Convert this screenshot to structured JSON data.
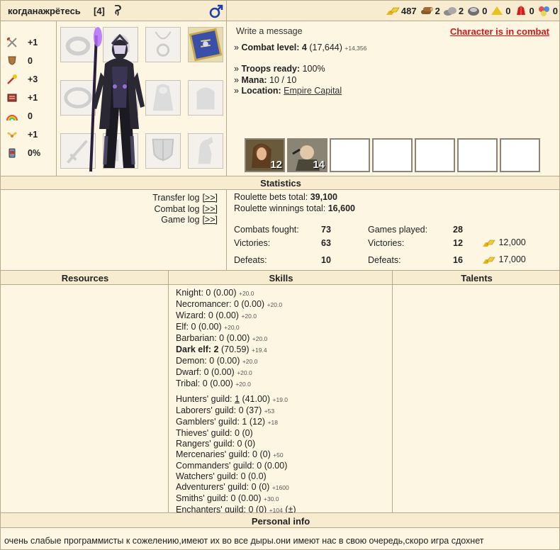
{
  "header": {
    "nickname": "когданажрётесь",
    "level": "[4]",
    "gender_icon": "male-symbol-icon",
    "resources": [
      {
        "icon": "gold-icon",
        "value": "487"
      },
      {
        "icon": "wood-icon",
        "value": "2"
      },
      {
        "icon": "ore-icon",
        "value": "2"
      },
      {
        "icon": "mercury-icon",
        "value": "0"
      },
      {
        "icon": "sulfur-icon",
        "value": "0"
      },
      {
        "icon": "crystal-icon",
        "value": "0"
      },
      {
        "icon": "gem-icon",
        "value": "0"
      }
    ]
  },
  "char_stats": [
    {
      "icon": "attack-swords-icon",
      "value": "+1"
    },
    {
      "icon": "defense-shield-icon",
      "value": "0"
    },
    {
      "icon": "spellpower-wand-icon",
      "value": "+3"
    },
    {
      "icon": "knowledge-book-icon",
      "value": "+1"
    },
    {
      "icon": "luck-rainbow-icon",
      "value": "0"
    },
    {
      "icon": "morale-wings-icon",
      "value": "+1"
    },
    {
      "icon": "tavern-cup-icon",
      "value": "0%"
    }
  ],
  "info": {
    "write_message": "Write a message",
    "combat_status": "Character is in combat",
    "combat_level_label": "Combat level:",
    "combat_level": "4",
    "combat_exp": "(17,644)",
    "combat_exp_bonus": "+14,356",
    "troops_label": "Troops ready:",
    "troops": "100%",
    "mana_label": "Mana:",
    "mana": "10 / 10",
    "location_label": "Location:",
    "location": "Empire Capital"
  },
  "army": [
    {
      "count": "12"
    },
    {
      "count": "14"
    }
  ],
  "statistics": {
    "title": "Statistics",
    "logs": [
      {
        "label": "Transfer log",
        "link": "[>>]"
      },
      {
        "label": "Combat log",
        "link": "[>>]"
      },
      {
        "label": "Game log",
        "link": "[>>]"
      }
    ],
    "roulette_bets_label": "Roulette bets total:",
    "roulette_bets": "39,100",
    "roulette_win_label": "Roulette winnings total:",
    "roulette_win": "16,600",
    "combats_label": "Combats fought:",
    "combats": "73",
    "victories_label": "Victories:",
    "victories": "63",
    "defeats_label": "Defeats:",
    "defeats": "10",
    "games_label": "Games played:",
    "games": "28",
    "g_victories_label": "Victories:",
    "g_victories": "12",
    "g_victories_gold": "12,000",
    "g_defeats_label": "Defeats:",
    "g_defeats": "16",
    "g_defeats_gold": "17,000"
  },
  "columns": {
    "resources": "Resources",
    "skills": "Skills",
    "talents": "Talents"
  },
  "skills": [
    {
      "name": "Knight:",
      "level": "0",
      "pts": "(0.00)",
      "bonus": "+20.0",
      "bold": false
    },
    {
      "name": "Necromancer:",
      "level": "0",
      "pts": "(0.00)",
      "bonus": "+20.0",
      "bold": false
    },
    {
      "name": "Wizard:",
      "level": "0",
      "pts": "(0.00)",
      "bonus": "+20.0",
      "bold": false
    },
    {
      "name": "Elf:",
      "level": "0",
      "pts": "(0.00)",
      "bonus": "+20.0",
      "bold": false
    },
    {
      "name": "Barbarian:",
      "level": "0",
      "pts": "(0.00)",
      "bonus": "+20.0",
      "bold": false
    },
    {
      "name": "Dark elf:",
      "level": "2",
      "pts": "(70.59)",
      "bonus": "+19.4",
      "bold": true
    },
    {
      "name": "Demon:",
      "level": "0",
      "pts": "(0.00)",
      "bonus": "+20.0",
      "bold": false
    },
    {
      "name": "Dwarf:",
      "level": "0",
      "pts": "(0.00)",
      "bonus": "+20.0",
      "bold": false
    },
    {
      "name": "Tribal:",
      "level": "0",
      "pts": "(0.00)",
      "bonus": "+20.0",
      "bold": false
    }
  ],
  "guilds": [
    {
      "name": "Hunters' guild:",
      "level": "1",
      "pts": "(41.00)",
      "bonus": "+19.0",
      "level_link": true
    },
    {
      "name": "Laborers' guild:",
      "level": "0",
      "pts": "(37)",
      "bonus": "+53"
    },
    {
      "name": "Gamblers' guild:",
      "level": "1",
      "pts": "(12)",
      "bonus": "+18"
    },
    {
      "name": "Thieves' guild:",
      "level": "0",
      "pts": "(0)",
      "bonus": ""
    },
    {
      "name": "Rangers' guild:",
      "level": "0",
      "pts": "(0)",
      "bonus": ""
    },
    {
      "name": "Mercenaries' guild:",
      "level": "0",
      "pts": "(0)",
      "bonus": "+50"
    },
    {
      "name": "Commanders' guild:",
      "level": "0",
      "pts": "(0.00)",
      "bonus": ""
    },
    {
      "name": "Watchers' guild:",
      "level": "0",
      "pts": "(0.0)",
      "bonus": ""
    },
    {
      "name": "Adventurers' guild:",
      "level": "0",
      "pts": "(0)",
      "bonus": "+1600"
    },
    {
      "name": "Smiths' guild:",
      "level": "0",
      "pts": "(0.00)",
      "bonus": "+30.0"
    },
    {
      "name": "Enchanters' guild:",
      "level": "0",
      "pts": "(0)",
      "bonus": "+104",
      "extra": "(±)"
    }
  ],
  "personal": {
    "title": "Personal info",
    "text": "очень слабые программисты к сожелению,имеют их во все дыры.они имеют нас в свою очередь,скоро игра сдохнет"
  }
}
